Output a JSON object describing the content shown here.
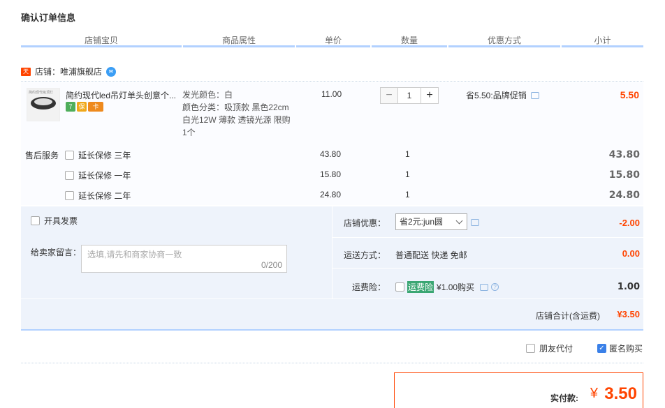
{
  "page_title": "确认订单信息",
  "columns": [
    "店铺宝贝",
    "商品属性",
    "单价",
    "数量",
    "优惠方式",
    "小计"
  ],
  "shop": {
    "tag": "天猫",
    "label": "店铺：唯浦旗舰店",
    "ww_icon": "ww-icon"
  },
  "item": {
    "thumb_text": "简约现代吸顶灯",
    "name": "简约现代led吊灯单头创意个...",
    "badges": [
      "7",
      "保",
      "卡"
    ],
    "props": [
      "发光颜色：白",
      "颜色分类：吸顶款 黑色22cm",
      "白光12W 薄款 透镜光源 限购",
      "1个"
    ],
    "price": "11.00",
    "qty": "1",
    "minus": "−",
    "plus": "+",
    "promo": "省5.50:品牌促销",
    "subtotal": "5.50"
  },
  "after_sale": {
    "label": "售后服务",
    "options": [
      {
        "name": "延长保修 三年",
        "price": "43.80",
        "qty": "1",
        "subtotal": "43.80"
      },
      {
        "name": "延长保修 一年",
        "price": "15.80",
        "qty": "1",
        "subtotal": "15.80"
      },
      {
        "name": "延长保修 二年",
        "price": "24.80",
        "qty": "1",
        "subtotal": "24.80"
      }
    ]
  },
  "invoice": {
    "label": "开具发票"
  },
  "memo": {
    "label": "给卖家留言：",
    "placeholder": "选填,请先和商家协商一致",
    "count": "0/200"
  },
  "shop_discount": {
    "label": "店铺优惠：",
    "selected": "省2元:jun圆",
    "value": "-2.00"
  },
  "shipping": {
    "label": "运送方式：",
    "value_text": "普通配送 快递 免邮",
    "value": "0.00"
  },
  "insurance": {
    "label": "运费险：",
    "tag": "运费险",
    "text": "¥1.00购买",
    "value": "1.00"
  },
  "shop_total": {
    "label": "店铺合计(含运费)",
    "value": "¥3.50"
  },
  "options": {
    "friend_pay": "朋友代付",
    "anonymous": "匿名购买"
  },
  "payment": {
    "label": "实付款:",
    "yen": "¥",
    "value": "3.50"
  }
}
